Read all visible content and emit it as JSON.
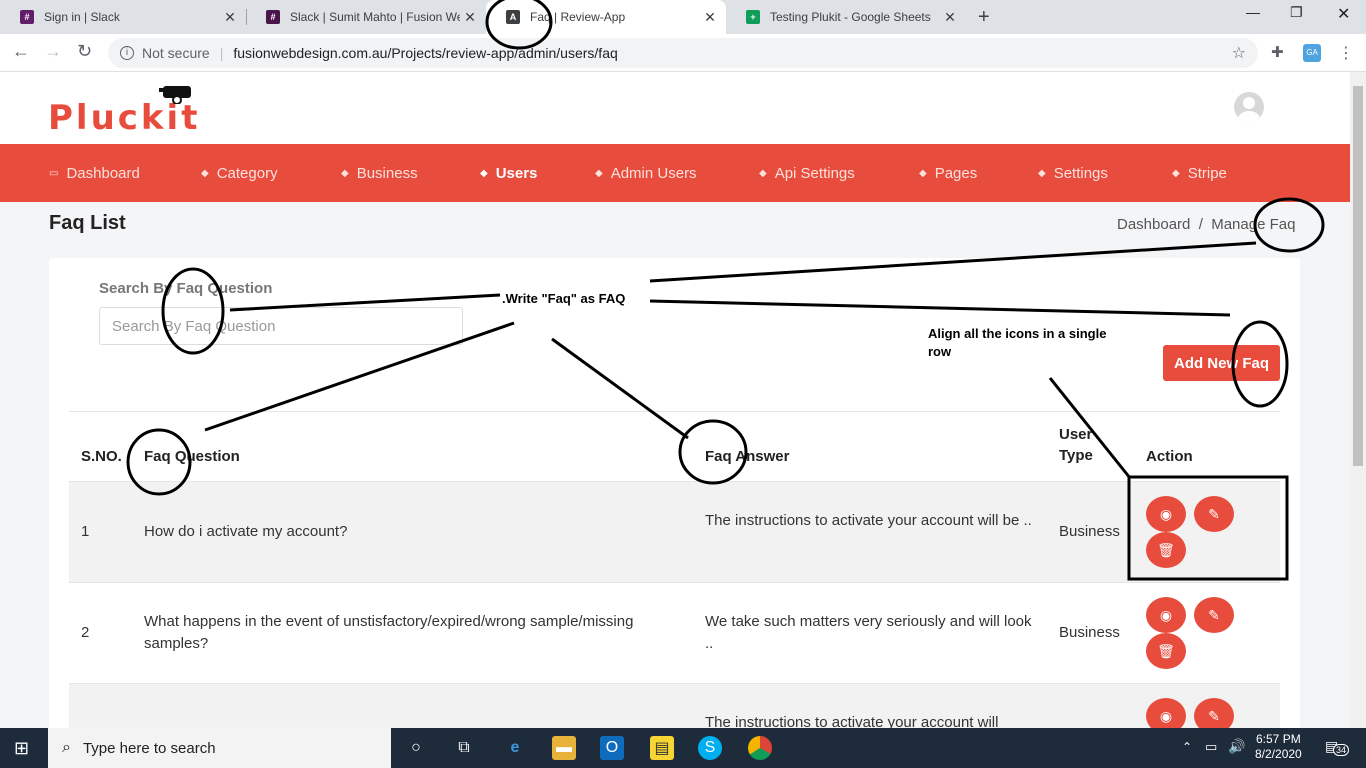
{
  "browser": {
    "tabs": [
      {
        "title": "Sign in | Slack",
        "icon": "slack-icon"
      },
      {
        "title": "Slack | Sumit Mahto | Fusion Web",
        "icon": "slack-icon"
      },
      {
        "title": "Faq | Review-App",
        "icon": "app-icon"
      },
      {
        "title": "Testing Plukit - Google Sheets",
        "icon": "sheets-icon"
      }
    ],
    "url_security": "Not secure",
    "url": "fusionwebdesign.com.au/Projects/review-app/admin/users/faq"
  },
  "site": {
    "logo": "Pluckit"
  },
  "nav": [
    {
      "label": "Dashboard",
      "icon": "monitor-icon"
    },
    {
      "label": "Category",
      "icon": "layers-icon"
    },
    {
      "label": "Business",
      "icon": "layers-icon"
    },
    {
      "label": "Users",
      "icon": "layers-icon"
    },
    {
      "label": "Admin Users",
      "icon": "layers-icon"
    },
    {
      "label": "Api Settings",
      "icon": "layers-icon"
    },
    {
      "label": "Pages",
      "icon": "layers-icon"
    },
    {
      "label": "Settings",
      "icon": "layers-icon"
    },
    {
      "label": "Stripe",
      "icon": "layers-icon"
    }
  ],
  "page": {
    "title": "Faq List",
    "breadcrumb": "Dashboard  /  Manage Faq"
  },
  "search": {
    "label": "Search By Faq Question",
    "placeholder": "Search By Faq Question"
  },
  "add_button": "Add New Faq",
  "table": {
    "headers": [
      "S.NO.",
      "Faq Question",
      "Faq Answer",
      "User",
      "Type",
      "Action"
    ],
    "rows": [
      {
        "sno": "1",
        "question": "How do i activate my account?",
        "answer": "The instructions to activate your account will be ..",
        "type": "Business"
      },
      {
        "sno": "2",
        "question": "What happens in the event of unstisfactory/expired/wrong sample/missing samples?",
        "answer": "We take such matters very seriously and will look ..",
        "type": "Business"
      },
      {
        "sno": "",
        "question": "",
        "answer": "The instructions to activate your account will",
        "type": ""
      }
    ]
  },
  "annotations": {
    "note1": ".Write \"Faq\"  as FAQ",
    "note2": "Align all the icons in a single row"
  },
  "taskbar": {
    "search_placeholder": "Type here to search",
    "time": "6:57 PM",
    "date": "8/2/2020",
    "notifications": "34"
  },
  "colors": {
    "brand": "#e84c3d"
  }
}
